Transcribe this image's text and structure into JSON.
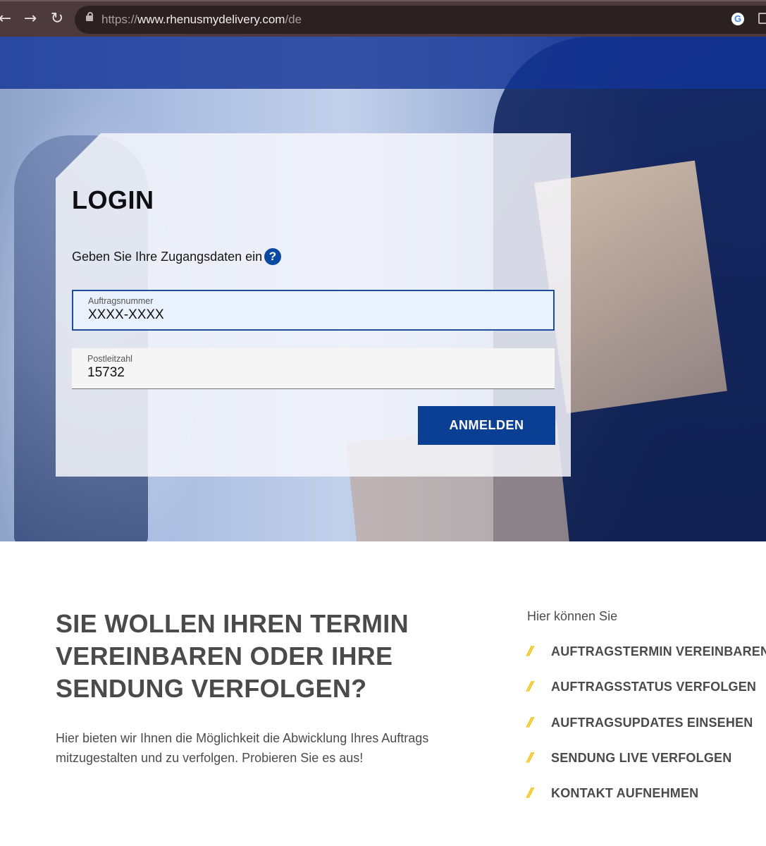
{
  "browser": {
    "url_prefix": "https://",
    "url_host": "www.rhenusmydelivery.com",
    "url_path": "/de",
    "back_glyph": "←",
    "forward_glyph": "→",
    "reload_glyph": "↻",
    "google_glyph": "G"
  },
  "login": {
    "title": "LOGIN",
    "subtitle": "Geben Sie Ihre Zugangsdaten ein",
    "help_glyph": "?",
    "order_field": {
      "label": "Auftragsnummer",
      "value": "XXXX-XXXX"
    },
    "zip_field": {
      "label": "Postleitzahl",
      "value": "15732"
    },
    "submit_label": "ANMELDEN"
  },
  "info": {
    "heading": "SIE WOLLEN IHREN TERMIN VEREINBAREN ODER IHRE SENDUNG VERFOLGEN?",
    "text": "Hier bieten wir Ihnen die Möglichkeit die Abwicklung Ihres Auftrags mitzugestalten und zu verfolgen. Probieren Sie es aus!"
  },
  "features": {
    "intro": "Hier können Sie",
    "bullet_glyph": "//",
    "items": [
      {
        "label": "AUFTRAGSTERMIN VEREINBAREN"
      },
      {
        "label": "AUFTRAGSSTATUS VERFOLGEN"
      },
      {
        "label": "AUFTRAGSUPDATES EINSEHEN"
      },
      {
        "label": "SENDUNG LIVE VERFOLGEN"
      },
      {
        "label": "KONTAKT AUFNEHMEN"
      }
    ]
  },
  "colors": {
    "primary_blue": "#0a3f94",
    "accent_yellow": "#f2c413",
    "heading_gray": "#4a4a4d"
  }
}
